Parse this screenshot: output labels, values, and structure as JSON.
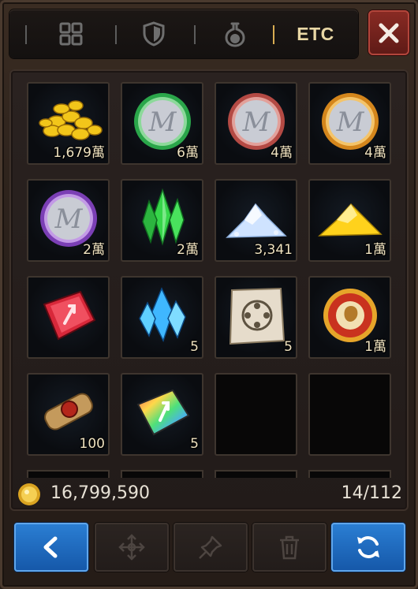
{
  "tabs": [
    {
      "name": "all-tab",
      "icon": "grid-icon"
    },
    {
      "name": "equipment-tab",
      "icon": "shield-icon"
    },
    {
      "name": "consumable-tab",
      "icon": "potion-icon"
    },
    {
      "name": "etc-tab",
      "label": "ETC",
      "active": true
    }
  ],
  "close_icon": "close-icon",
  "items": [
    {
      "name": "gold-coins",
      "icon": "gold-coins-icon",
      "qty": "1,679萬",
      "color": "#e8c21f"
    },
    {
      "name": "green-medal",
      "icon": "green-medal-icon",
      "qty": "6萬",
      "color": "#3fbf5a"
    },
    {
      "name": "red-medal",
      "icon": "red-medal-icon",
      "qty": "4萬",
      "color": "#c4574f"
    },
    {
      "name": "orange-medal",
      "icon": "orange-medal-icon",
      "qty": "4萬",
      "color": "#e09a2a"
    },
    {
      "name": "purple-medal",
      "icon": "purple-medal-icon",
      "qty": "2萬",
      "color": "#9b5fd0"
    },
    {
      "name": "green-crystal",
      "icon": "green-crystal-icon",
      "qty": "2萬",
      "color": "#35d34a"
    },
    {
      "name": "white-powder",
      "icon": "white-powder-icon",
      "qty": "3,341",
      "color": "#cfe3ff"
    },
    {
      "name": "gold-powder",
      "icon": "gold-powder-icon",
      "qty": "1萬",
      "color": "#ffd21c"
    },
    {
      "name": "red-stone",
      "icon": "red-stone-icon",
      "qty": "",
      "color": "#d8283a"
    },
    {
      "name": "blue-crystal",
      "icon": "blue-crystal-icon",
      "qty": "5",
      "color": "#3fb7ff"
    },
    {
      "name": "map-scroll",
      "icon": "map-scroll-icon",
      "qty": "5",
      "color": "#e6dccb"
    },
    {
      "name": "lion-medal",
      "icon": "lion-medal-icon",
      "qty": "1萬",
      "color": "#c9321f"
    },
    {
      "name": "parchment-scroll",
      "icon": "scroll-icon",
      "qty": "100",
      "color": "#b88a4a"
    },
    {
      "name": "rainbow-stone",
      "icon": "rainbow-stone-icon",
      "qty": "5",
      "color": "#6fd6a6"
    },
    {
      "name": "empty",
      "icon": "",
      "qty": "",
      "color": ""
    },
    {
      "name": "empty",
      "icon": "",
      "qty": "",
      "color": ""
    }
  ],
  "footer": {
    "gold_icon": "gold-coin-icon",
    "gold_amount": "16,799,590",
    "capacity": "14/112"
  },
  "buttons": [
    {
      "name": "back-button",
      "icon": "chevron-left-icon",
      "style": "blue"
    },
    {
      "name": "move-button",
      "icon": "move-arrows-icon",
      "style": "dim"
    },
    {
      "name": "pin-button",
      "icon": "pin-icon",
      "style": "dim"
    },
    {
      "name": "delete-button",
      "icon": "trash-icon",
      "style": "dim"
    },
    {
      "name": "sort-button",
      "icon": "refresh-icon",
      "style": "blue"
    }
  ]
}
